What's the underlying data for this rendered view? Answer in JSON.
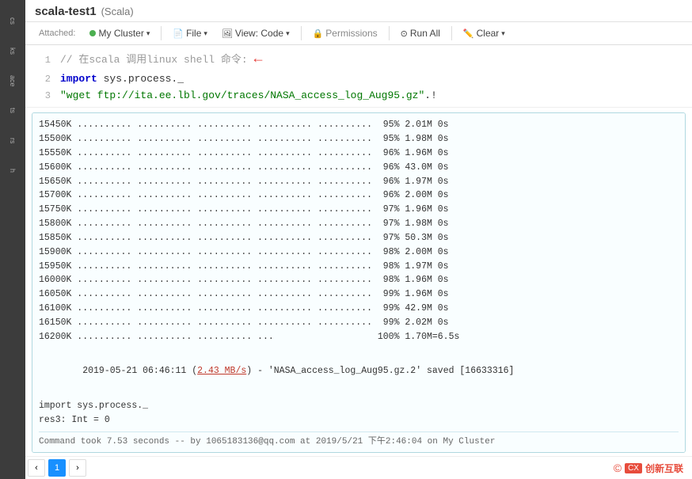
{
  "app": {
    "title": "scala-test1",
    "lang": "(Scala)"
  },
  "toolbar": {
    "attached_label": "Attached:",
    "cluster_label": "My Cluster",
    "file_label": "File",
    "view_label": "View: Code",
    "permissions_label": "Permissions",
    "run_all_label": "Run All",
    "clear_label": "Clear"
  },
  "code": {
    "lines": [
      {
        "num": "1",
        "content": "// 在scala 调用linux shell 命令:"
      },
      {
        "num": "2",
        "content": "import sys.process._"
      },
      {
        "num": "3",
        "content": "\"wget ftp://ita.ee.lbl.gov/traces/NASA_access_log_Aug95.gz\".!"
      }
    ]
  },
  "output": {
    "progress_lines": [
      "15450K .......... .......... .......... .......... ..........  95% 2.01M 0s",
      "15500K .......... .......... .......... .......... ..........  95% 1.98M 0s",
      "15550K .......... .......... .......... .......... ..........  96% 1.96M 0s",
      "15600K .......... .......... .......... .......... ..........  96% 43.0M 0s",
      "15650K .......... .......... .......... .......... ..........  96% 1.97M 0s",
      "15700K .......... .......... .......... .......... ..........  96% 2.00M 0s",
      "15750K .......... .......... .......... .......... ..........  97% 1.96M 0s",
      "15800K .......... .......... .......... .......... ..........  97% 1.98M 0s",
      "15850K .......... .......... .......... .......... ..........  97% 50.3M 0s",
      "15900K .......... .......... .......... .......... ..........  98% 2.00M 0s",
      "15950K .......... .......... .......... .......... ..........  98% 1.97M 0s",
      "16000K .......... .......... .......... .......... ..........  98% 1.96M 0s",
      "16050K .......... .......... .......... .......... ..........  99% 1.96M 0s",
      "16100K .......... .......... .......... .......... ..........  99% 42.9M 0s",
      "16150K .......... .......... .......... .......... ..........  99% 2.02M 0s",
      "16200K .......... .......... .......... ...                   100% 1.70M=6.5s"
    ],
    "saved_line": "2019-05-21 06:46:11 (2.43 MB/s) - 'NASA_access_log_Aug95.gz.2' saved [16633316]",
    "saved_highlight": "2.43 MB/s",
    "import_line": "import sys.process._",
    "result_line": "res3: Int = 0",
    "status_line": "Command took 7.53 seconds -- by 1065183136@qq.com at 2019/5/21 下午2:46:04 on My Cluster"
  },
  "sidebar": {
    "items": [
      "cs",
      "ks",
      "ace",
      "ts",
      "rs",
      "h"
    ]
  },
  "watermark": {
    "text": "创新互联",
    "prefix": "CX"
  }
}
